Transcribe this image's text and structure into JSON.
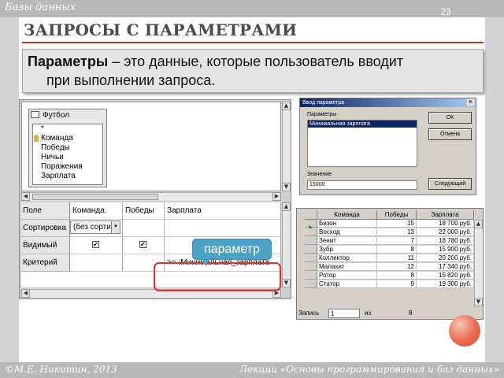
{
  "header": {
    "category": "Базы данных",
    "page_number": "23"
  },
  "title": "ЗАПРОСЫ С ПАРАМЕТРАМИ",
  "definition": {
    "term": "Параметры",
    "text": " – это данные, которые пользователь вводит",
    "text2": "при выполнении запроса."
  },
  "query_designer": {
    "table_name": "Футбол",
    "fields": [
      "*",
      "Команда",
      "Победы",
      "Ничьи",
      "Поражения",
      "Зарплата"
    ],
    "key_field_index": 1,
    "row_labels": [
      "Поле",
      "Сортировка",
      "Видимый",
      "Критерий"
    ],
    "columns": [
      {
        "field": "Команда",
        "sort": "(без сорти",
        "visible": true,
        "criterion": ""
      },
      {
        "field": "Победы",
        "sort": "",
        "visible": true,
        "criterion": ""
      },
      {
        "field": "Зарплата",
        "sort": "",
        "visible": true,
        "criterion": ">= :Минимальная_зарплата"
      }
    ],
    "check_glyph": "✔"
  },
  "callout": {
    "label": "параметр",
    "color": "#4aa3c6",
    "highlight_color": "#e0312a"
  },
  "param_dialog": {
    "title": "Ввод параметра",
    "params_label": "Параметры",
    "selected_param": "Минимальная зарплата",
    "value_label": "Значение",
    "value": "15000",
    "ok_label": "ОК",
    "cancel_label": "Отмена",
    "next_label": "Следующий"
  },
  "result": {
    "headers": [
      "Команда",
      "Победы",
      "Зарплата"
    ],
    "rows": [
      [
        "Бизон",
        "15",
        "18 700 руб."
      ],
      [
        "Восход",
        "13",
        "22 000 руб."
      ],
      [
        "Зенит",
        "7",
        "18 780 руб."
      ],
      [
        "Зубр",
        "8",
        "15 900 руб."
      ],
      [
        "Коллектор",
        "11",
        "20 200 руб."
      ],
      [
        "Малахит",
        "12",
        "17 340 руб."
      ],
      [
        "Ротор",
        "8",
        "15 820 руб."
      ],
      [
        "Статор",
        "9",
        "19 300 руб."
      ]
    ],
    "current_row_index": 0,
    "nav_label": "Запись",
    "nav_current": "1",
    "nav_of": "из",
    "nav_total": "8"
  },
  "footer": {
    "left": "©М.Е. Никитин, 2013",
    "right": "Лекции «Основы программирования и баз данных»"
  },
  "colors": {
    "accent": "#c0312b",
    "bars": "#b8b8b8"
  }
}
